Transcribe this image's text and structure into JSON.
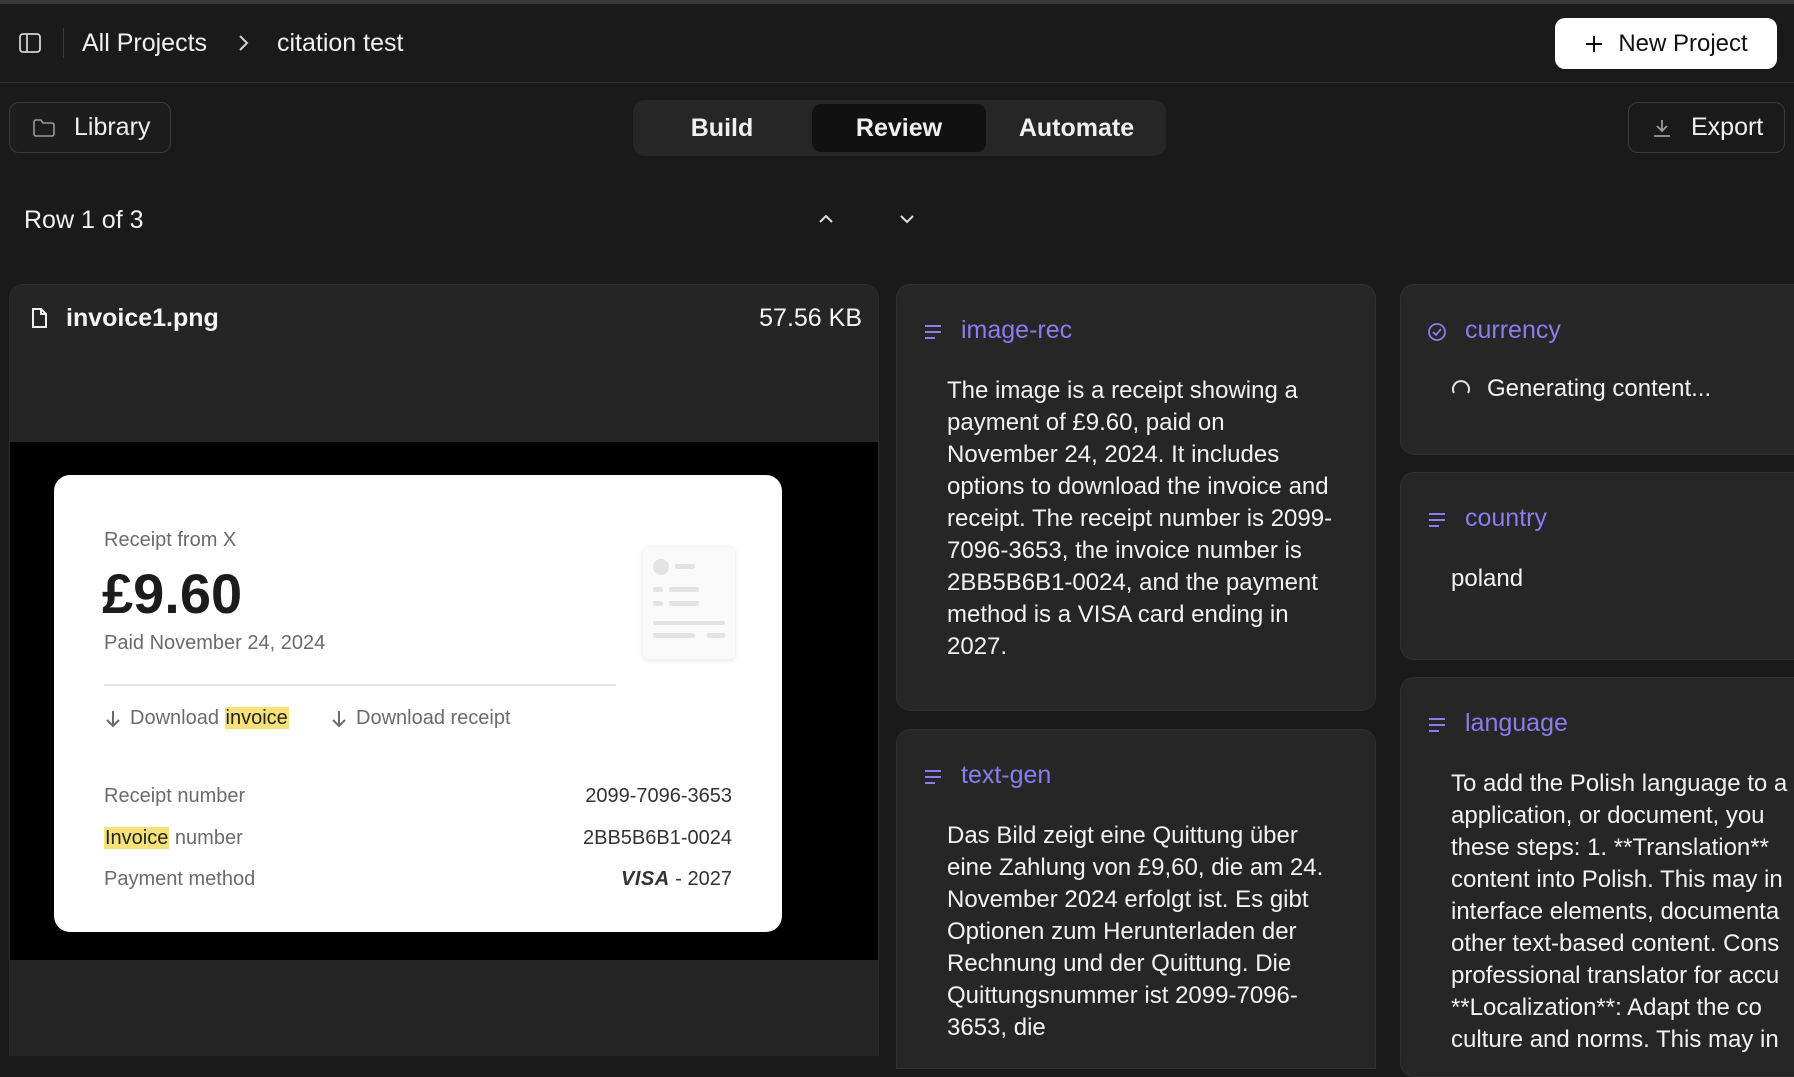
{
  "header": {
    "breadcrumb_root": "All Projects",
    "breadcrumb_current": "citation test",
    "new_project_label": "New Project"
  },
  "toolbar": {
    "library_label": "Library",
    "tabs": [
      {
        "label": "Build",
        "active": false
      },
      {
        "label": "Review",
        "active": true
      },
      {
        "label": "Automate",
        "active": false
      }
    ],
    "export_label": "Export"
  },
  "navigation": {
    "row_counter": "Row 1 of 3"
  },
  "file": {
    "name": "invoice1.png",
    "size": "57.56 KB"
  },
  "receipt": {
    "from": "Receipt from X",
    "amount": "£9.60",
    "paid": "Paid November 24, 2024",
    "download_prefix": "Download",
    "download_invoice_highlight": "invoice",
    "download_receipt": "Download receipt",
    "rows": [
      {
        "label": "Receipt number",
        "value": "2099-7096-3653"
      },
      {
        "label_highlight": "Invoice",
        "label_rest": " number",
        "value": "2BB5B6B1-0024"
      },
      {
        "label": "Payment method",
        "brand": "VISA",
        "value": "- 2027"
      }
    ]
  },
  "cards": {
    "image_rec": {
      "title": "image-rec",
      "text": "The image is a receipt showing a payment of £9.60, paid on November 24, 2024. It includes options to download the invoice and receipt. The receipt number is 2099-7096-3653, the invoice number is 2BB5B6B1-0024, and the payment method is a VISA card ending in 2027."
    },
    "text_gen": {
      "title": "text-gen",
      "text": "Das Bild zeigt eine Quittung über eine Zahlung von £9,60, die am 24. November 2024 erfolgt ist. Es gibt Optionen zum Herunterladen der Rechnung und der Quittung. Die Quittungsnummer ist 2099-7096-3653, die"
    },
    "currency": {
      "title": "currency",
      "status": "Generating content..."
    },
    "country": {
      "title": "country",
      "text": "poland"
    },
    "language": {
      "title": "language",
      "lines": [
        "To add the Polish language to a",
        "application, or document, you",
        "these steps: 1. **Translation**",
        "content into Polish. This may in",
        "interface elements, documenta",
        "other text-based content. Cons",
        "professional translator for accu",
        "**Localization**: Adapt the co",
        "culture and norms. This may in"
      ]
    }
  },
  "colors": {
    "background": "#1a1a1a",
    "card": "#262626",
    "accent": "#8b7cf0",
    "highlight": "#f7e27a"
  }
}
